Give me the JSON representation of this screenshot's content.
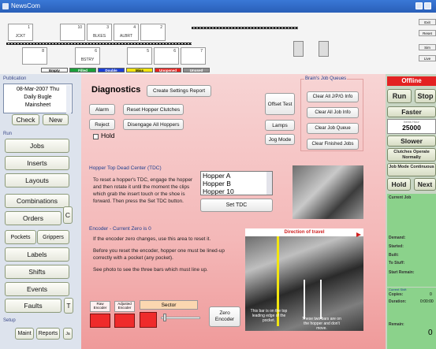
{
  "window": {
    "title": "NewsCom"
  },
  "top": {
    "slots": [
      {
        "num": "1",
        "label": "JCKT"
      },
      {
        "num": "10",
        "label": ""
      },
      {
        "num": "3",
        "label": "BLKES"
      },
      {
        "num": "4",
        "label": "ALBRT"
      },
      {
        "num": "2",
        "label": ""
      },
      {
        "num": "8",
        "label": ""
      },
      {
        "num": "6",
        "label": "BSTRY"
      },
      {
        "num": "5",
        "label": ""
      },
      {
        "num": "6",
        "label": ""
      },
      {
        "num": "7",
        "label": ""
      }
    ],
    "legend": [
      {
        "label": "Empty",
        "color": "#ffffff"
      },
      {
        "label": "Filled",
        "color": "#1aa13a"
      },
      {
        "label": "Double",
        "color": "#1b3fd6"
      },
      {
        "label": "Miss",
        "color": "#f2e510"
      },
      {
        "label": "Unopened",
        "color": "#e8231f"
      },
      {
        "label": "Unused",
        "color": "#909090"
      }
    ],
    "small_buttons": [
      "Exit",
      "Reset",
      "Sim",
      "Live"
    ]
  },
  "left": {
    "publication_label": "Publication",
    "publication_lines": [
      "08-Mar-2007 Thu",
      "Daily Bugle",
      "Mainsheet"
    ],
    "check": "Check",
    "new": "New",
    "run_label": "Run",
    "jobs": "Jobs",
    "inserts": "Inserts",
    "layouts": "Layouts",
    "combinations": "Combinations",
    "orders": "Orders",
    "orders_side": "C",
    "pockets": "Pockets",
    "grippers": "Grippers",
    "labels": "Labels",
    "shifts": "Shifts",
    "events": "Events",
    "faults": "Faults",
    "faults_side": "T",
    "setup_label": "Setup",
    "maint": "Maint",
    "reports": "Reports",
    "more": "Ja"
  },
  "main": {
    "title": "Diagnostics",
    "create_report": "Create Settings Report",
    "alarm": "Alarm",
    "reset_hopper": "Reset Hopper Clutches",
    "reject": "Reject",
    "disengage": "Disengage All Hoppers",
    "hold": "Hold",
    "offset_test": "Offset Test",
    "lamps": "Lamps",
    "jog_mode": "Jog Mode",
    "brain_queue_label": "Brain's Job Queues",
    "clear_jpg": "Clear All J/P/G Info",
    "clear_job_info": "Clear All Job Info",
    "clear_job_queue": "Clear Job Queue",
    "clear_finished": "Clear Finished Jobs",
    "tdc_header": "Hopper Top Dead Center (TDC)",
    "tdc_text": "To reset a hopper's TDC, engage the hopper and then rotate it until the moment the clips which grab the insert touch or the shoe is forward. Then press the Set TDC button.",
    "hoppers": [
      "Hopper A",
      "Hopper B",
      "Hopper 10"
    ],
    "set_tdc": "Set TDC",
    "encoder_header": "Encoder  - Current Zero is 0",
    "enc_text1": "If the encoder zero changes, use this area to reset it.",
    "enc_text2": "Before you reset the encoder, hopper one must be lined-up correctly with a pocket (any pocket).",
    "enc_text3": "See photo to see the three bars which must line up.",
    "raw_encoder": "Raw Encoder",
    "adjusted_encoder": "Adjusted Encoder",
    "sector": "Sector",
    "zero_encoder": "Zero Encoder",
    "direction": "Direction of travel",
    "photo_note1": "This bar is on the top leading edge of the pocket.",
    "photo_note2": "These two bars are on the hopper and don't move."
  },
  "right": {
    "status": "Offline",
    "run": "Run",
    "stop": "Stop",
    "faster": "Faster",
    "speed_label": "Items Hour",
    "speed": "25000",
    "slower": "Slower",
    "clutches": "Clutches Operate Normally",
    "job_mode": "Job Mode Continuous",
    "hold": "Hold",
    "next": "Next",
    "current_job": "Current Job",
    "demand": "Demand:",
    "started": "Started:",
    "built": "Built:",
    "to_stuff": "To Stuff:",
    "start_remain": "Start Remain:",
    "current_shift": "Current Shift",
    "copies": "Copies:",
    "copies_val": "0",
    "duration": "Duration:",
    "duration_val": "0:00:00",
    "remain": "Remain:",
    "remain_val": "0"
  }
}
